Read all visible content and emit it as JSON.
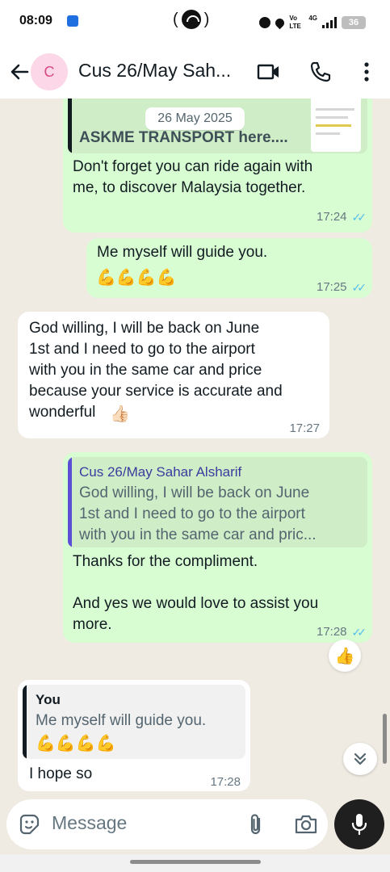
{
  "status_bar": {
    "time": "08:09",
    "center_left": "(",
    "center_right": ")",
    "network_label": "Vo LTE",
    "signal_label": "4G",
    "battery": "36"
  },
  "header": {
    "avatar_letter": "C",
    "title": "Cus 26/May Sah..."
  },
  "chat": {
    "date_chip": "26 May 2025",
    "messages": [
      {
        "quote_title": "ASKME TRANSPORT here....",
        "text": "Don't forget you can ride again with\nme, to discover Malaysia together.",
        "time": "17:24"
      },
      {
        "text": "Me myself will guide you.",
        "emoji": "💪💪💪💪",
        "time": "17:25"
      },
      {
        "text": "God willing, I will be back on June\n1st and I need to go to the airport\nwith you in the same car and price\nbecause your service is accurate and\nwonderful",
        "emoji": "👍🏻",
        "time": "17:27"
      },
      {
        "quote_author": "Cus 26/May Sahar Alsharif",
        "quote_text": "God willing, I will be back on June\n1st and I need to go to the airport\nwith you in the same car and pric...",
        "text": "Thanks for the compliment.\n\nAnd yes we would love to assist you\nmore.",
        "time": "17:28",
        "reaction": "👍"
      },
      {
        "quote_author": "You",
        "quote_text": "Me myself will guide you.",
        "quote_emoji": "💪💪💪💪",
        "text": "I hope so",
        "time": "17:28"
      }
    ]
  },
  "composer": {
    "placeholder": "Message"
  },
  "colors": {
    "outgoing_bubble": "#d9fdd3",
    "incoming_bubble": "#ffffff",
    "read_ticks": "#53bdeb",
    "chat_background": "#efeae2",
    "quote_bar_customer": "#5b4fd6",
    "quote_author_customer": "#3b3b9e",
    "quote_bar_self": "#111b21",
    "mic_button": "#1f1f1f"
  },
  "icons": [
    "back-arrow-icon",
    "video-call-icon",
    "phone-icon",
    "more-vert-icon",
    "sticker-icon",
    "attach-icon",
    "camera-icon",
    "mic-icon",
    "double-chevron-down-icon",
    "read-ticks-icon"
  ]
}
